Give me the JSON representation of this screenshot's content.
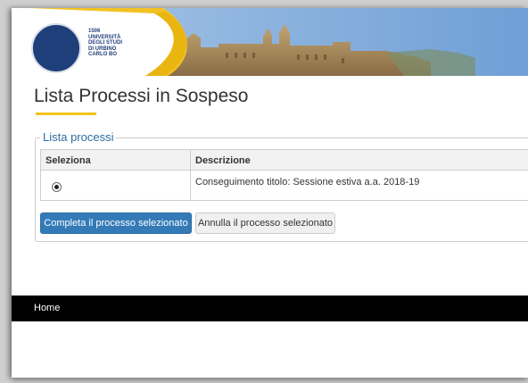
{
  "header": {
    "logo_lines": "1506\nUNIVERSITÀ\nDEGLI STUDI\nDI URBINO\nCARLO BO"
  },
  "page": {
    "title": "Lista Processi in Sospeso"
  },
  "process_list": {
    "legend": "Lista processi",
    "columns": [
      "Seleziona",
      "Descrizione"
    ],
    "rows": [
      {
        "selected": true,
        "description": "Conseguimento titolo: Sessione estiva a.a. 2018-19"
      }
    ]
  },
  "actions": {
    "complete_label": "Completa il processo selezionato",
    "cancel_label": "Annulla il processo selezionato"
  },
  "footer": {
    "home_label": "Home"
  },
  "colors": {
    "accent_blue": "#337ab7",
    "underline_yellow": "#f0c419",
    "logo_blue": "#1f3f7a",
    "footer_bg": "#000000"
  }
}
